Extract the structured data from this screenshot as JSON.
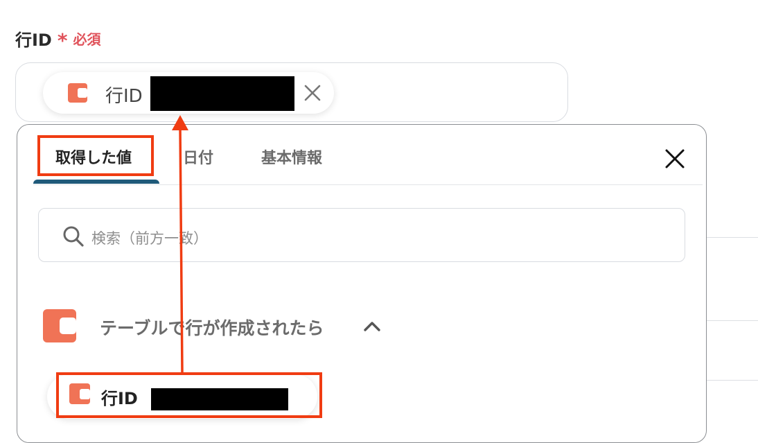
{
  "field": {
    "label": "行ID",
    "required_star": "*",
    "required_text": "必須"
  },
  "chip": {
    "label": "行ID",
    "close_icon": "close-icon",
    "logo_icon": "coda-logo-icon"
  },
  "panel": {
    "tabs": [
      {
        "label": "取得した値",
        "active": true
      },
      {
        "label": "日付",
        "active": false
      },
      {
        "label": "基本情報",
        "active": false
      }
    ],
    "close_icon": "close-icon",
    "search": {
      "icon": "search-icon",
      "placeholder": "検索（前方一致）"
    },
    "section": {
      "title": "テーブルで行が作成されたら",
      "expanded": true,
      "items": [
        {
          "label": "行ID"
        }
      ]
    }
  },
  "colors": {
    "accent_underline": "#1f5a7a",
    "coda_orange": "#f07356",
    "highlight_red": "#f03c12",
    "required_red": "#e0535b"
  }
}
